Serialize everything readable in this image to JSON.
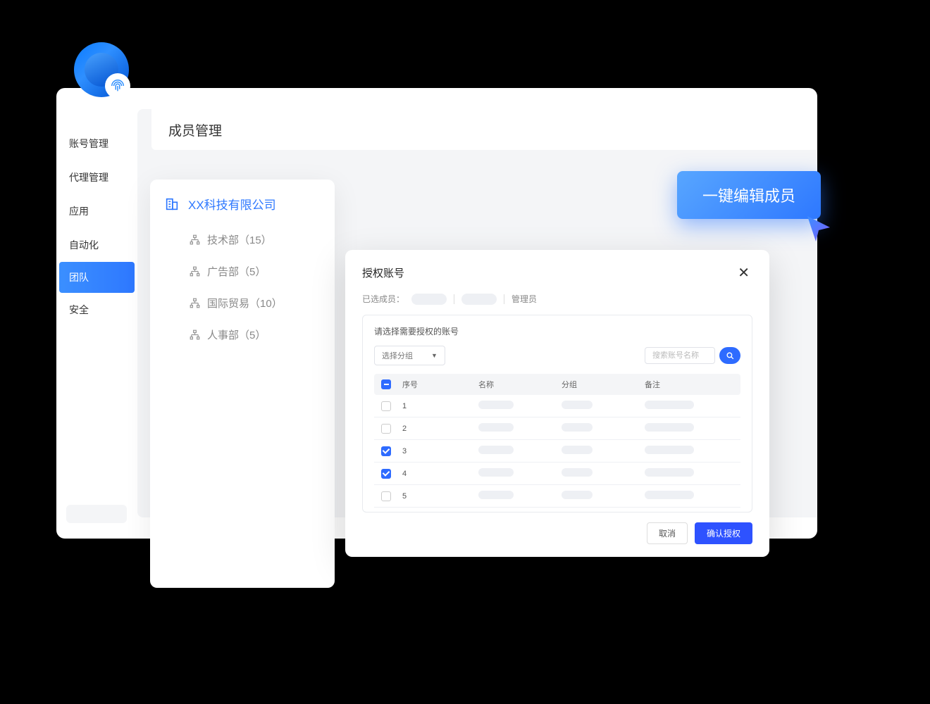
{
  "sidebar": {
    "items": [
      {
        "label": "账号管理",
        "active": false
      },
      {
        "label": "代理管理",
        "active": false
      },
      {
        "label": "应用",
        "active": false
      },
      {
        "label": "自动化",
        "active": false
      },
      {
        "label": "团队",
        "active": true
      },
      {
        "label": "安全",
        "active": false
      }
    ]
  },
  "page": {
    "title": "成员管理"
  },
  "org": {
    "company": "XX科技有限公司",
    "departments": [
      {
        "label": "技术部（15）"
      },
      {
        "label": "广告部（5）"
      },
      {
        "label": "国际贸易（10）"
      },
      {
        "label": "人事部（5）"
      }
    ]
  },
  "action_button": {
    "label": "一键编辑成员"
  },
  "modal": {
    "title": "授权账号",
    "selected_label": "已选成员：",
    "role_label": "管理员",
    "hint": "请选择需要授权的账号",
    "group_dropdown": "选择分组",
    "search_placeholder": "搜索账号名称",
    "columns": {
      "seq": "序号",
      "name": "名称",
      "group": "分组",
      "note": "备注"
    },
    "rows": [
      {
        "seq": "1",
        "checked": false
      },
      {
        "seq": "2",
        "checked": false
      },
      {
        "seq": "3",
        "checked": true
      },
      {
        "seq": "4",
        "checked": true
      },
      {
        "seq": "5",
        "checked": false
      }
    ],
    "cancel": "取消",
    "confirm": "确认授权"
  }
}
